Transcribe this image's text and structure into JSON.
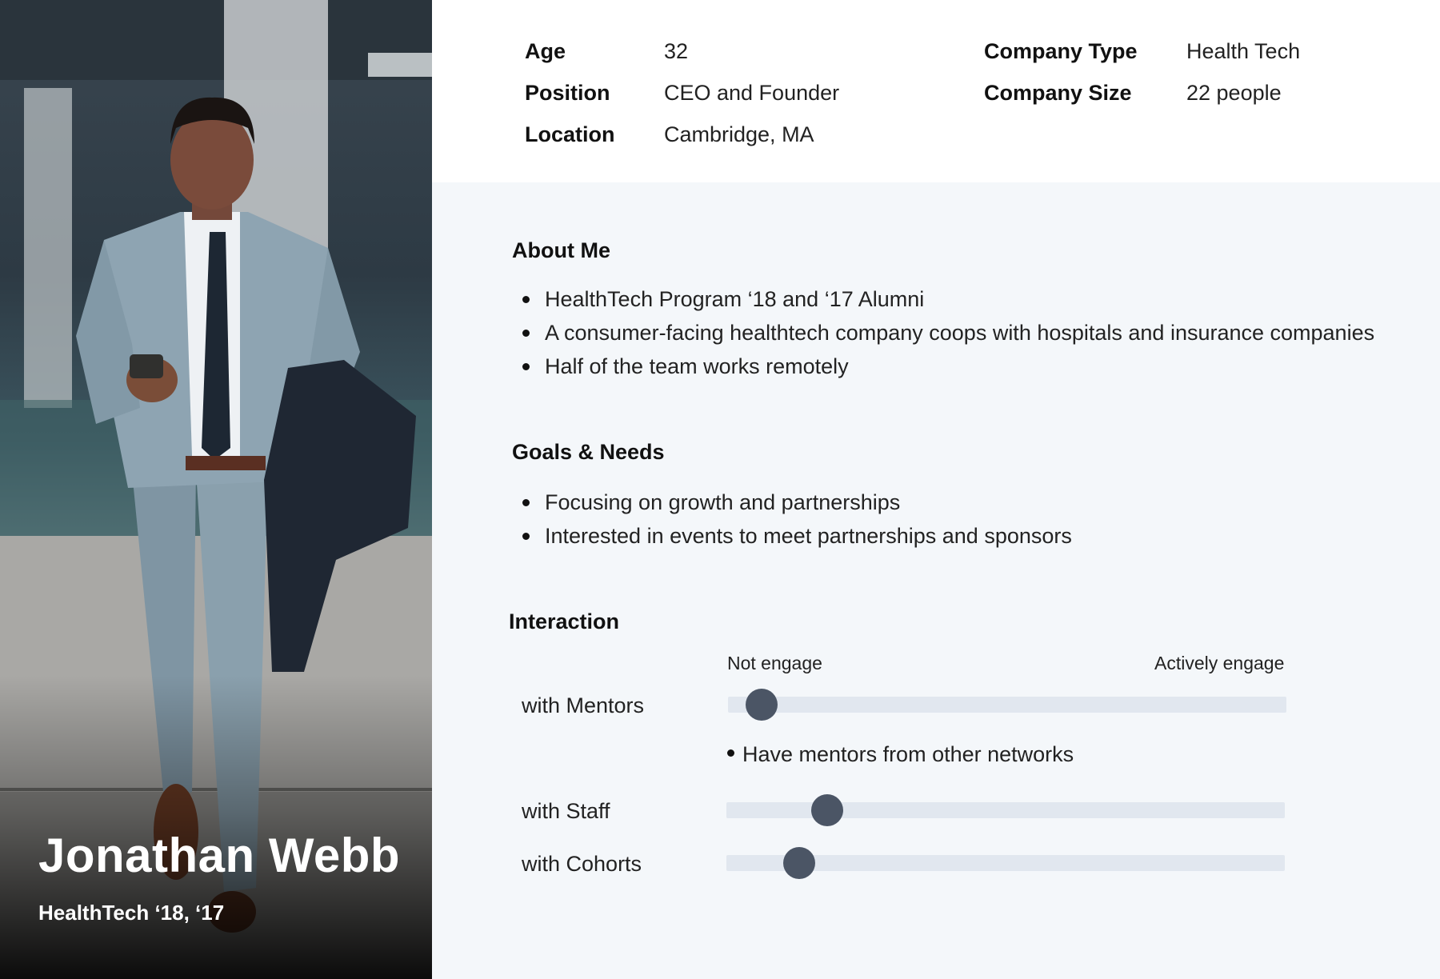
{
  "persona": {
    "name": "Jonathan Webb",
    "subtitle": "HealthTech ‘18, ‘17"
  },
  "details": {
    "left": [
      {
        "label": "Age",
        "value": "32"
      },
      {
        "label": "Position",
        "value": "CEO and Founder"
      },
      {
        "label": "Location",
        "value": "Cambridge, MA"
      }
    ],
    "right": [
      {
        "label": "Company Type",
        "value": "Health Tech"
      },
      {
        "label": "Company Size",
        "value": "22 people"
      }
    ]
  },
  "about": {
    "title": "About Me",
    "items": [
      "HealthTech Program ‘18 and ‘17 Alumni",
      "A consumer-facing healthtech company coops with hospitals and insurance companies",
      "Half of the team works remotely"
    ]
  },
  "goals": {
    "title": "Goals & Needs",
    "items": [
      "Focusing on growth and partnerships",
      "Interested in events to meet partnerships and sponsors"
    ]
  },
  "interaction": {
    "title": "Interaction",
    "scale_min_label": "Not engage",
    "scale_max_label": "Actively engage",
    "rows": [
      {
        "label": "with Mentors",
        "level": 0.06,
        "note": "Have mentors from other networks"
      },
      {
        "label": "with Staff",
        "level": 0.18
      },
      {
        "label": "with Cohorts",
        "level": 0.13
      }
    ],
    "knob_color": "#4b5565",
    "track_color": "#e1e7ef"
  }
}
